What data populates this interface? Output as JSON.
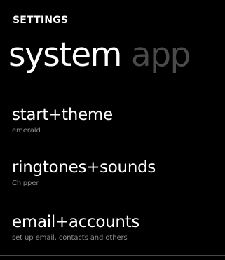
{
  "header": {
    "section_title": "SETTINGS"
  },
  "pivot": {
    "active_label": "system",
    "next_label": "app"
  },
  "settings_list": [
    {
      "title": "start+theme",
      "subtitle": "emerald"
    },
    {
      "title": "ringtones+sounds",
      "subtitle": "Chipper"
    },
    {
      "title": "email+accounts",
      "subtitle": "set up email, contacts and others"
    }
  ],
  "colors": {
    "background": "#000000",
    "text_primary": "#ffffff",
    "text_secondary": "#8c8c8c",
    "pivot_inactive": "#4a4a4a",
    "highlight_rule": "#c4121a"
  }
}
